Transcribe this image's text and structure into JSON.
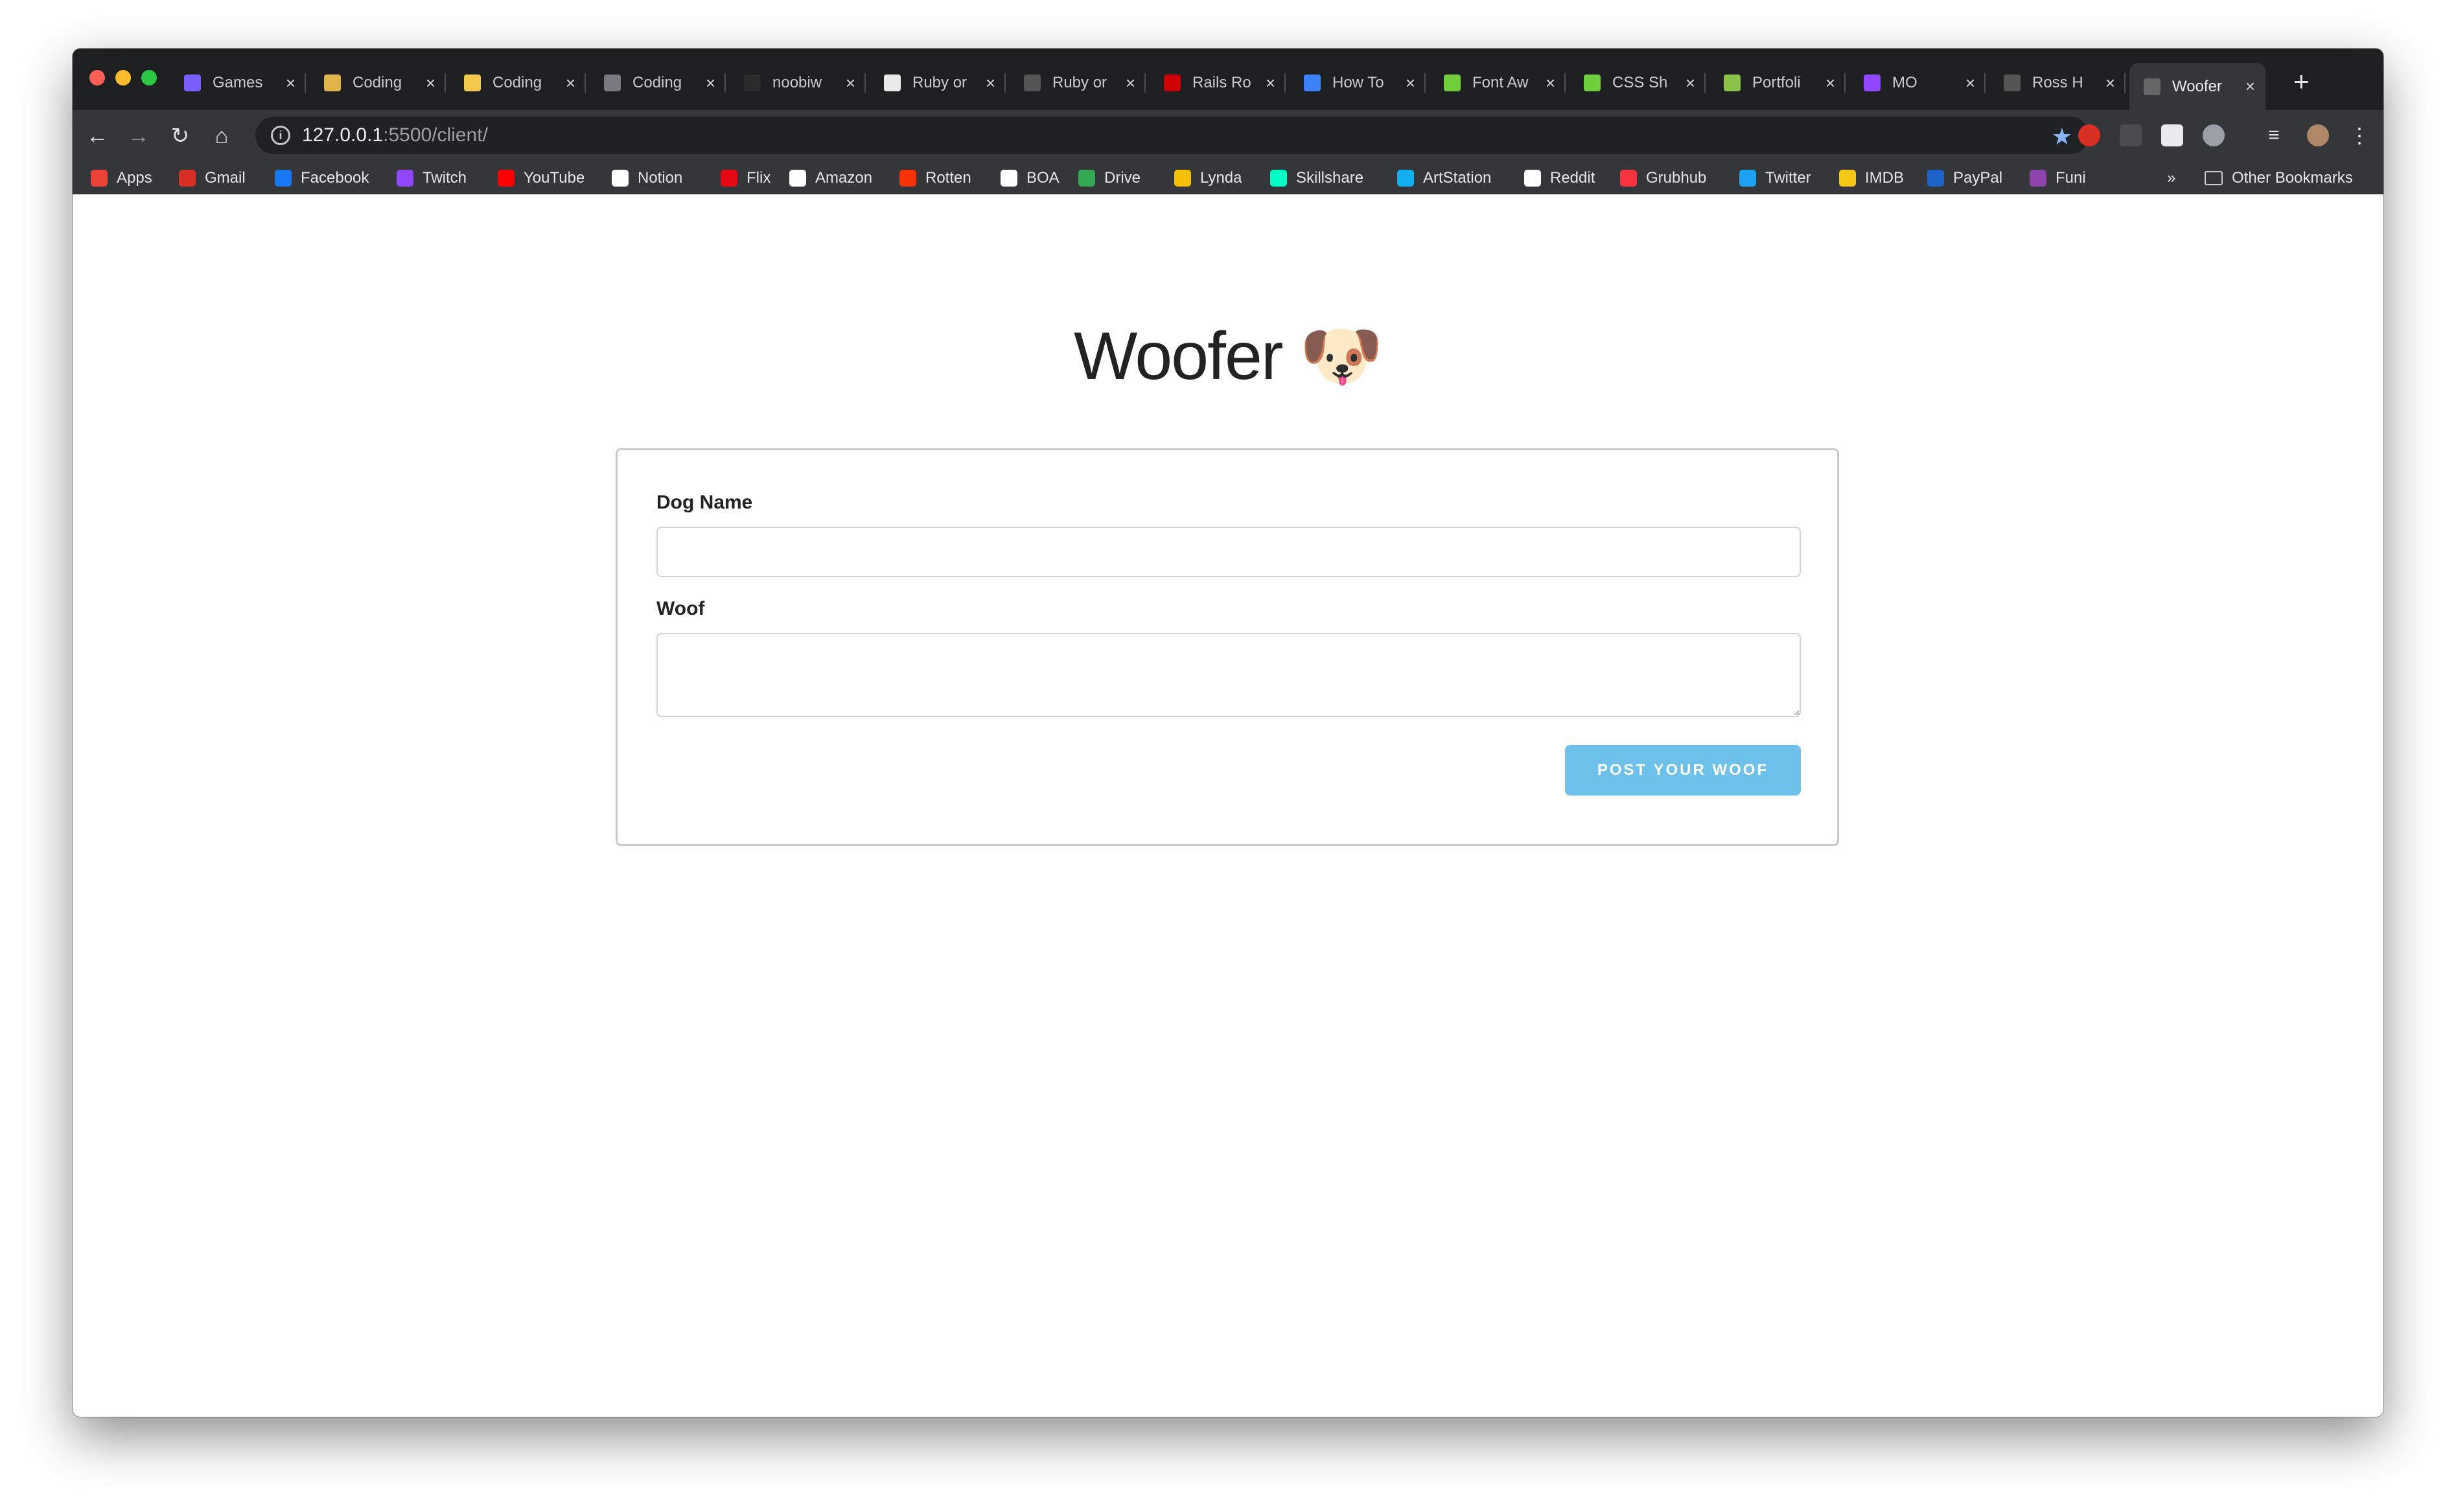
{
  "browser": {
    "tabs": [
      {
        "title": "Games",
        "icon": "games-icon",
        "color": "#7a5cff"
      },
      {
        "title": "Coding",
        "icon": "coding-icon",
        "color": "#e0b44a"
      },
      {
        "title": "Coding",
        "icon": "notes-icon",
        "color": "#f2c94c"
      },
      {
        "title": "Coding",
        "icon": "notebook-icon",
        "color": "#777a80"
      },
      {
        "title": "noobiw",
        "icon": "github-icon",
        "color": "#2b2b2b"
      },
      {
        "title": "Ruby or",
        "icon": "ruby-guide-icon",
        "color": "#eaeaea"
      },
      {
        "title": "Ruby or",
        "icon": "globe-icon",
        "color": "#555"
      },
      {
        "title": "Rails Ro",
        "icon": "rails-icon",
        "color": "#cc0000"
      },
      {
        "title": "How To",
        "icon": "dots-icon",
        "color": "#3b82f6"
      },
      {
        "title": "Font Aw",
        "icon": "font-awesome-icon",
        "color": "#6fcf3a"
      },
      {
        "title": "CSS Sh",
        "icon": "css-icon",
        "color": "#6fcf3a"
      },
      {
        "title": "Portfoli",
        "icon": "portfolio-icon",
        "color": "#8bc34a"
      },
      {
        "title": "MO",
        "icon": "twitch-icon",
        "color": "#9146ff"
      },
      {
        "title": "Ross H",
        "icon": "globe-icon",
        "color": "#555"
      },
      {
        "title": "Woofer",
        "icon": "globe-icon",
        "color": "#666"
      }
    ],
    "url_host": "127.0.0.1",
    "url_path": ":5500/client/",
    "bookmarks": [
      {
        "label": "Apps",
        "color": "#ea4335",
        "icon": "apps-grid-icon"
      },
      {
        "label": "Gmail",
        "color": "#d93025",
        "icon": "gmail-icon"
      },
      {
        "label": "Facebook",
        "color": "#1877f2",
        "icon": "facebook-icon"
      },
      {
        "label": "Twitch",
        "color": "#9146ff",
        "icon": "twitch-icon"
      },
      {
        "label": "YouTube",
        "color": "#ff0000",
        "icon": "youtube-icon"
      },
      {
        "label": "Notion",
        "color": "#ffffff",
        "icon": "notion-icon"
      },
      {
        "label": "Flix",
        "color": "#e50914",
        "icon": "netflix-icon"
      },
      {
        "label": "Amazon",
        "color": "#ffffff",
        "icon": "amazon-icon"
      },
      {
        "label": "Rotten",
        "color": "#fa320a",
        "icon": "tomato-icon"
      },
      {
        "label": "BOA",
        "color": "#ffffff",
        "icon": "globe-icon"
      },
      {
        "label": "Drive",
        "color": "#34a853",
        "icon": "drive-icon"
      },
      {
        "label": "Lynda",
        "color": "#f5c000",
        "icon": "lynda-icon"
      },
      {
        "label": "Skillshare",
        "color": "#00ffc4",
        "icon": "skillshare-icon"
      },
      {
        "label": "ArtStation",
        "color": "#13aff0",
        "icon": "artstation-icon"
      },
      {
        "label": "Reddit",
        "color": "#ffffff",
        "icon": "globe-icon"
      },
      {
        "label": "Grubhub",
        "color": "#f63440",
        "icon": "grubhub-icon"
      },
      {
        "label": "Twitter",
        "color": "#1da1f2",
        "icon": "twitter-icon"
      },
      {
        "label": "IMDB",
        "color": "#f5c518",
        "icon": "imdb-icon"
      },
      {
        "label": "PayPal",
        "color": "#1e64c8",
        "icon": "paypal-icon"
      },
      {
        "label": "Funi",
        "color": "#8e44ad",
        "icon": "funimation-icon"
      }
    ],
    "more_bookmarks": "»",
    "other_bookmarks": "Other Bookmarks"
  },
  "page": {
    "title": "Woofer",
    "emoji": "🐶",
    "form": {
      "dog_name_label": "Dog Name",
      "dog_name_value": "",
      "woof_label": "Woof",
      "woof_value": "",
      "submit_label": "POST YOUR WOOF"
    }
  },
  "colors": {
    "accent_button": "#6ec1eb",
    "tab_bar": "#1e1f21",
    "toolbar": "#35363a"
  }
}
